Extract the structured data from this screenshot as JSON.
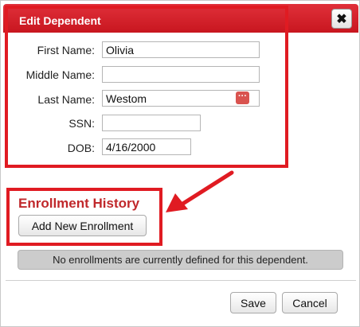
{
  "dialog": {
    "title": "Edit Dependent",
    "close_icon": "close-x-icon"
  },
  "form": {
    "first_name": {
      "label": "First Name:",
      "value": "Olivia"
    },
    "middle_name": {
      "label": "Middle Name:",
      "value": ""
    },
    "last_name": {
      "label": "Last Name:",
      "value": "Westom",
      "icon": "lookup-dots-icon"
    },
    "ssn": {
      "label": "SSN:",
      "value": ""
    },
    "dob": {
      "label": "DOB:",
      "value": "4/16/2000"
    }
  },
  "enrollment": {
    "title": "Enrollment History",
    "add_button": "Add New Enrollment",
    "empty_message": "No enrollments are currently defined for this dependent."
  },
  "footer": {
    "save": "Save",
    "cancel": "Cancel"
  },
  "colors": {
    "titlebar": "#d2232a",
    "highlight": "#e01b22",
    "section_title": "#c0282b"
  }
}
